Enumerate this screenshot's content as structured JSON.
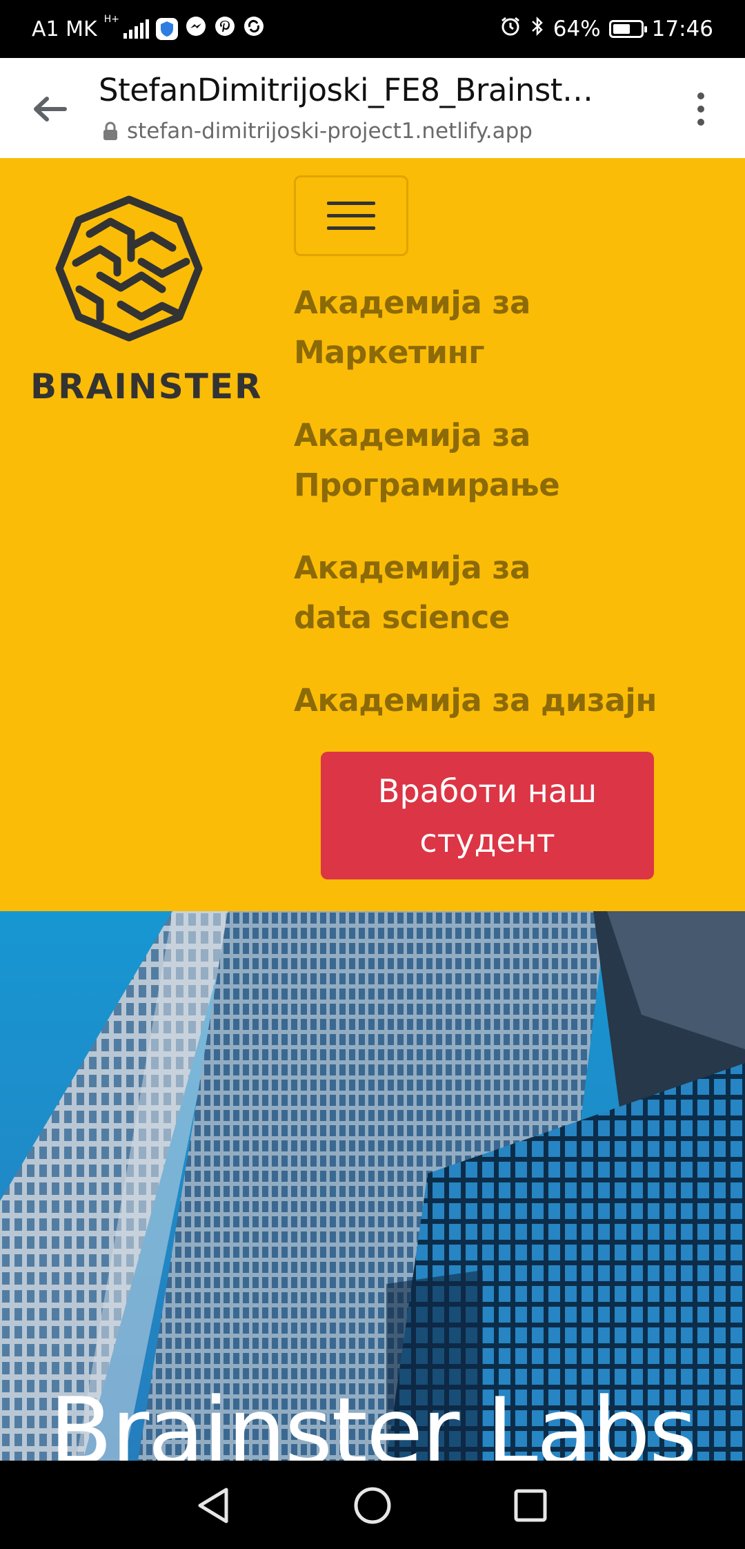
{
  "status_bar": {
    "carrier": "A1 MK",
    "network_type": "H+",
    "battery_percent": "64%",
    "battery_level": 0.64,
    "time": "17:46",
    "icons": [
      "signal-icon",
      "shield-app-icon",
      "messenger-icon",
      "pinterest-icon",
      "sync-icon",
      "alarm-icon",
      "bluetooth-icon",
      "battery-icon"
    ]
  },
  "browser": {
    "page_title": "StefanDimitrijoski_FE8_Brainst…",
    "url": "stefan-dimitrijoski-project1.netlify.app"
  },
  "header": {
    "brand": "BRAINSTER",
    "nav_items": [
      {
        "label": "Академија за Маркетинг"
      },
      {
        "label": "Академија за Програмирање"
      },
      {
        "label": "Академија за data science"
      },
      {
        "label": "Академија за дизајн"
      }
    ],
    "cta_label": "Вработи наш студент"
  },
  "hero": {
    "title": "Brainster Labs"
  },
  "colors": {
    "header_bg": "#fbbc07",
    "nav_text": "#8c6a08",
    "cta_bg": "#dc3545",
    "sky": "#1aa2e0"
  }
}
